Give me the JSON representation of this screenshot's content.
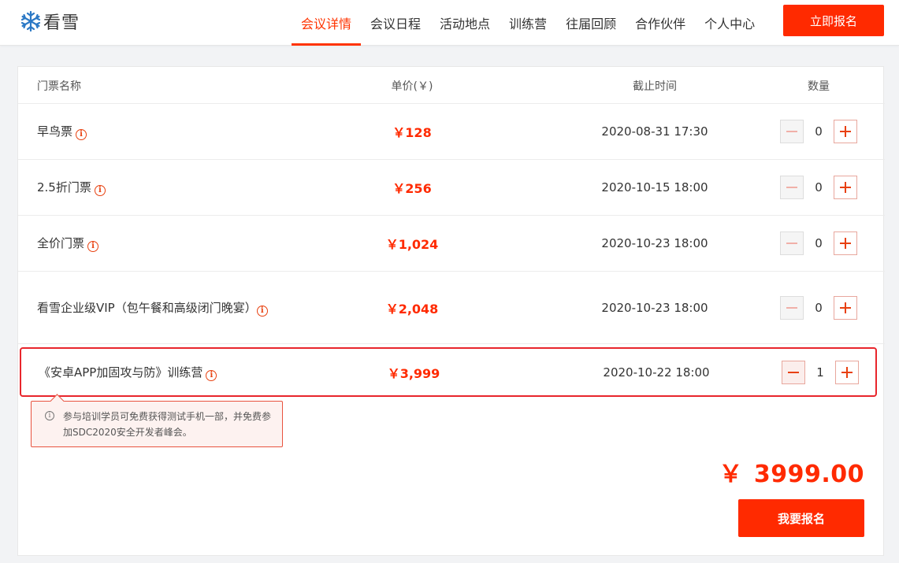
{
  "header": {
    "logo_text": "看雪",
    "nav": [
      {
        "label": "会议详情",
        "active": true
      },
      {
        "label": "会议日程",
        "active": false
      },
      {
        "label": "活动地点",
        "active": false
      },
      {
        "label": "训练营",
        "active": false
      },
      {
        "label": "往届回顾",
        "active": false
      },
      {
        "label": "合作伙伴",
        "active": false
      },
      {
        "label": "个人中心",
        "active": false
      }
    ],
    "register_now": "立即报名"
  },
  "table": {
    "columns": {
      "name": "门票名称",
      "price": "单价(￥)",
      "deadline": "截止时间",
      "quantity": "数量"
    },
    "rows": [
      {
        "name": "早鸟票",
        "price": "￥128",
        "deadline": "2020-08-31 17:30",
        "quantity": "0"
      },
      {
        "name": "2.5折门票",
        "price": "￥256",
        "deadline": "2020-10-15 18:00",
        "quantity": "0"
      },
      {
        "name": "全价门票",
        "price": "￥1,024",
        "deadline": "2020-10-23 18:00",
        "quantity": "0"
      },
      {
        "name": "看雪企业级VIP（包午餐和高级闭门晚宴）",
        "price": "￥2,048",
        "deadline": "2020-10-23 18:00",
        "quantity": "0"
      },
      {
        "name": "《安卓APP加固攻与防》训练营",
        "price": "￥3,999",
        "deadline": "2020-10-22 18:00",
        "quantity": "1"
      }
    ]
  },
  "tooltip": {
    "text": "参与培训学员可免费获得测试手机一部，并免费参加SDC2020安全开发者峰会。"
  },
  "total": {
    "currency": "￥",
    "amount": "3999.00"
  },
  "register_button": "我要报名",
  "colors": {
    "accent": "#ff2a00",
    "highlight_border": "#e8262c"
  },
  "icons": {
    "logo": "snowflake-icon",
    "info": "info-icon",
    "minus": "minus-icon",
    "plus": "plus-icon"
  }
}
